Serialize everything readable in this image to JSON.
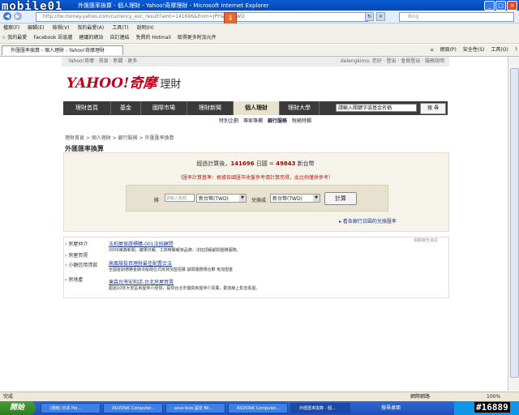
{
  "window": {
    "title": "外匯匯率換算 - 個人理財 - Yahoo!奇摩理財 - Microsoft Internet Explorer",
    "brand": "mobile01"
  },
  "address": {
    "url": "http://tw.money.yahoo.com/currency_exc_result?amt=141696&from=JPY&to=TWD",
    "search_placeholder": "Bing"
  },
  "menu": [
    "檔案(F)",
    "編輯(E)",
    "檢視(V)",
    "我的最愛(A)",
    "工具(T)",
    "說明(H)"
  ],
  "favorites": [
    "我的最愛",
    "Facebook 訊息牆",
    "建議的網站",
    "自訂連結",
    "免費的 Hotmail",
    "取得更多附加元件"
  ],
  "tab": {
    "label": "外匯匯率換算 - 個人理財 - Yahoo!奇摩理財"
  },
  "tabtools": [
    "網頁(P)",
    "安全性(S)",
    "工具(O)"
  ],
  "yahoo": {
    "topnav": "Yahoo!奇摩 · 首頁 · 新聞 · 更多",
    "user": "delengkimo, 您好 · 登出 · 會員登出 · 服務說明",
    "logo": "YAHOO!奇摩",
    "section": "理財",
    "tabs": [
      "理財首頁",
      "基金",
      "國際市場",
      "理財新聞",
      "個人理財",
      "理財大學"
    ],
    "search_placeholder": "請輸入關鍵字或基金名稱",
    "search_btn": "搜 尋",
    "subnav": [
      "特別企劃",
      "專家專欄",
      "銀行服務",
      "稅務特輯"
    ]
  },
  "breadcrumb": "理財首頁 > 個人理財 > 銀行服務 > 外匯匯率換算",
  "page_title": "外匯匯率換算",
  "result": {
    "prefix": "經過計算後，",
    "amount": "141696",
    "mid": " 日圓 = ",
    "converted": "49843",
    "suffix": " 新台幣"
  },
  "note": "（匯率計算基準：根據各國匯市收盤參考價計算而得，此比例僅供參考）",
  "form": {
    "amount_label": "將",
    "amount_placeholder": "請輸入金額",
    "from_currency": "新台幣(TWD)",
    "to_label": "兌換成",
    "to_currency": "新台幣(TWD)",
    "calc_btn": "計算"
  },
  "more_link": "看各銀行日圓的兌換匯率",
  "ad_label": "相關廣告資訊",
  "ads": [
    {
      "category": "房屋仲介",
      "title": "法拍屋保證標購-001法拍顧問",
      "desc": "2009東森新聞、蘋果日報、工商時報報導品牌，法拍頂級顧問團隊服務。"
    },
    {
      "category": "房屋買賣",
      "title": "",
      "desc": ""
    },
    {
      "category": "小額信用貸款",
      "title": "高風險投資理財最佳配置合法",
      "desc": "全國首創德勝金融法般隨位式房貸加盟招募 誠徵服務傳合夥 免加盟金"
    },
    {
      "category": "房地產",
      "title": "東森台灣安和店-台北房屋買賣",
      "desc": "超過10年大安區房屋仲介經營，提供台北市優質房屋仲介買賣，歡迎線上影音看屋。"
    }
  ],
  "status": {
    "left": "完成",
    "zone": "網際網路",
    "zoom": "100%"
  },
  "taskbar": {
    "start": "開始",
    "tasks": [
      "(漫雨) 日本 Poi...",
      "ASUSTeK Computer...",
      "asus bios 設定 Bli...",
      "ASUSTeK Computer...",
      "外匯匯率換算 - 個..."
    ],
    "tray_hint": "搜尋桌面",
    "watermark": "#16889"
  }
}
